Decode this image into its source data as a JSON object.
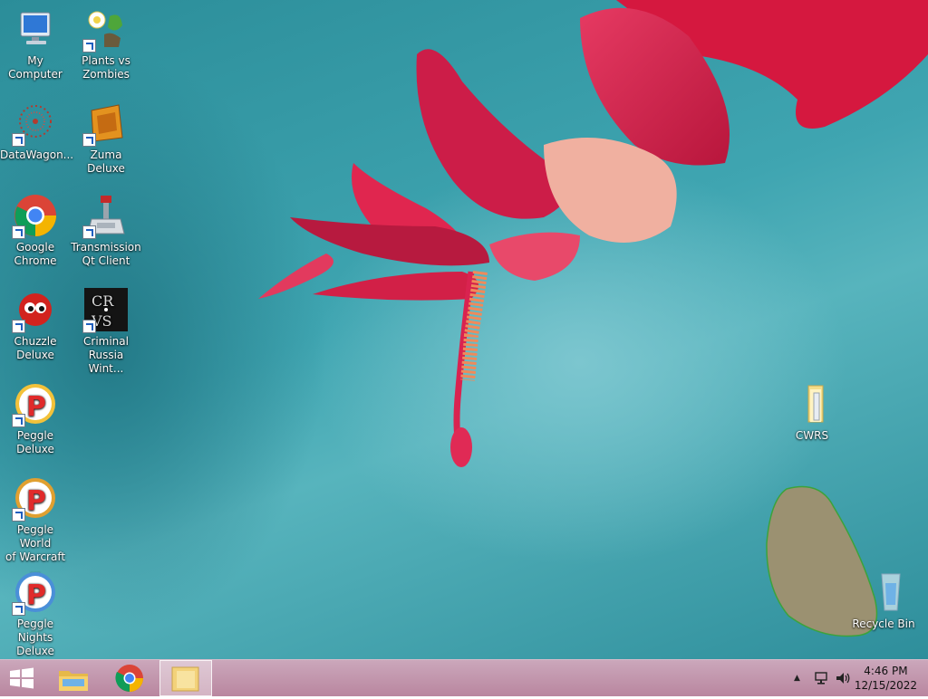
{
  "desktop_icons": [
    {
      "name": "my-computer",
      "label": "My Computer",
      "icon": "computer-icon"
    },
    {
      "name": "plants-vs-zombies",
      "label": "Plants vs\nZombies",
      "icon": "plants-vs-zombies-icon"
    },
    {
      "name": "datawagon",
      "label": "DataWagon...",
      "icon": "datawagon-icon"
    },
    {
      "name": "zuma-deluxe",
      "label": "Zuma Deluxe",
      "icon": "zuma-icon"
    },
    {
      "name": "google-chrome",
      "label": "Google\nChrome",
      "icon": "chrome-icon"
    },
    {
      "name": "transmission",
      "label": "Transmission\nQt Client",
      "icon": "transmission-icon"
    },
    {
      "name": "chuzzle-deluxe",
      "label": "Chuzzle\nDeluxe",
      "icon": "chuzzle-icon"
    },
    {
      "name": "criminal-russia",
      "label": "Criminal\nRussia Wint...",
      "icon": "criminal-russia-icon",
      "logo_text": [
        "CR",
        "VS"
      ]
    },
    {
      "name": "peggle-deluxe",
      "label": "Peggle Deluxe",
      "icon": "peggle-icon"
    },
    {
      "name": "peggle-world-of-warcraft",
      "label": "Peggle World\nof Warcraft ...",
      "icon": "peggle-icon"
    },
    {
      "name": "peggle-nights",
      "label": "Peggle Nights\nDeluxe",
      "icon": "peggle-icon"
    },
    {
      "name": "cwrs",
      "label": "CWRS",
      "icon": "folder-icon"
    },
    {
      "name": "recycle-bin",
      "label": "Recycle Bin",
      "icon": "recycle-bin-icon"
    }
  ],
  "taskbar": {
    "start": "windows-start-icon",
    "pinned": [
      "file-explorer-icon",
      "chrome-icon",
      "folder-window-icon"
    ],
    "tray": {
      "show_hidden": "▲",
      "network": "network-icon",
      "volume": "volume-icon"
    },
    "clock": {
      "time": "4:46 PM",
      "date": "12/15/2022"
    }
  },
  "colors": {
    "desktop": "#3fa5b1",
    "taskbar": "#c29bb1",
    "flower": "#e0264f"
  }
}
